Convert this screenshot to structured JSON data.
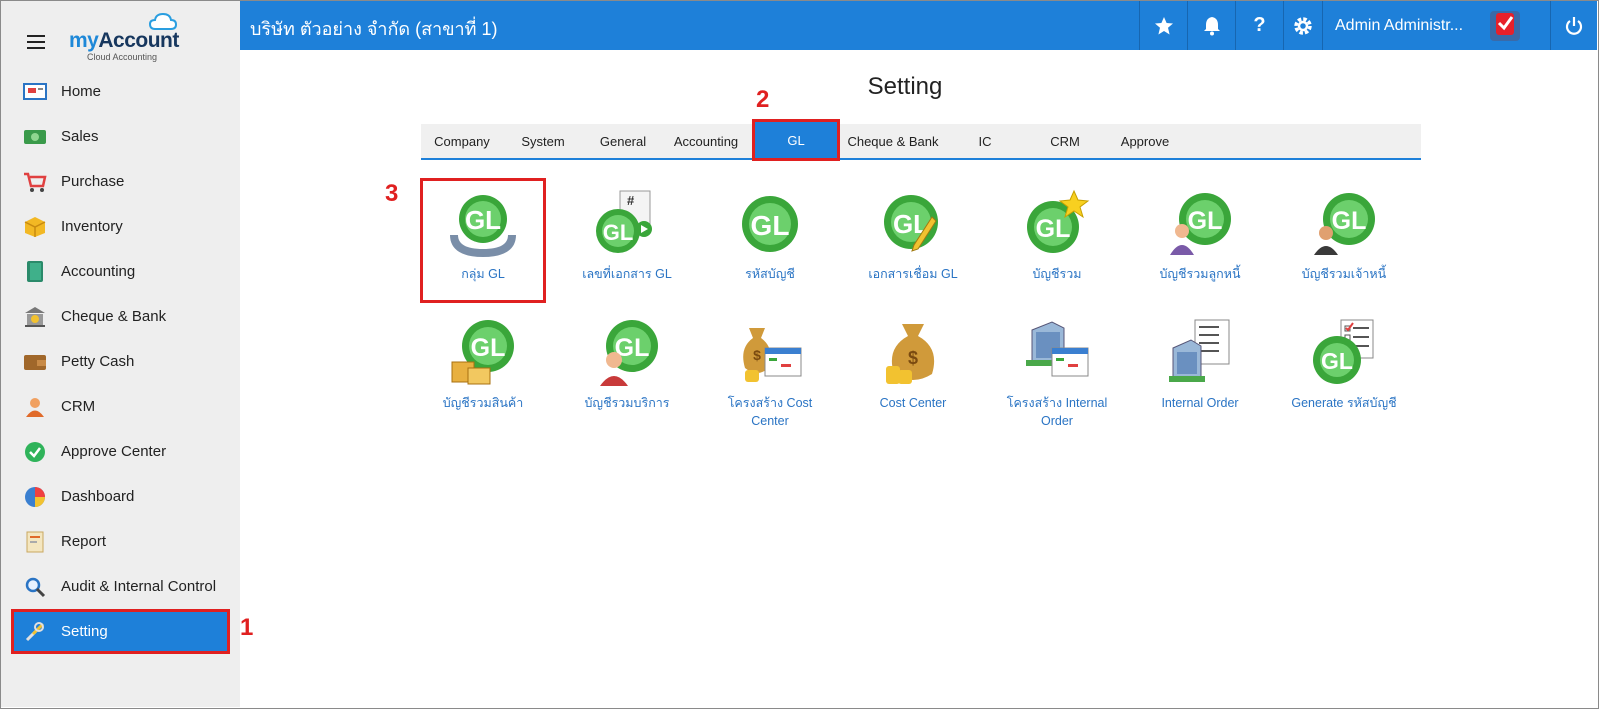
{
  "app": {
    "logo_text_my": "my",
    "logo_text_account": "Account",
    "logo_sub": "Cloud Accounting"
  },
  "topbar": {
    "company": "บริษัท ตัวอย่าง จำกัด (สาขาที่ 1)",
    "user": "Admin Administr...",
    "icons": [
      "star-icon",
      "bell-icon",
      "help-icon",
      "gear-icon",
      "power-icon"
    ]
  },
  "sidebar": {
    "items": [
      {
        "label": "Home",
        "icon": "home-icon"
      },
      {
        "label": "Sales",
        "icon": "money-icon"
      },
      {
        "label": "Purchase",
        "icon": "cart-icon"
      },
      {
        "label": "Inventory",
        "icon": "box-icon"
      },
      {
        "label": "Accounting",
        "icon": "book-icon"
      },
      {
        "label": "Cheque & Bank",
        "icon": "bank-icon"
      },
      {
        "label": "Petty Cash",
        "icon": "wallet-icon"
      },
      {
        "label": "CRM",
        "icon": "people-icon"
      },
      {
        "label": "Approve Center",
        "icon": "check-icon"
      },
      {
        "label": "Dashboard",
        "icon": "pie-icon"
      },
      {
        "label": "Report",
        "icon": "report-icon"
      },
      {
        "label": "Audit & Internal Control",
        "icon": "magnifier-icon"
      },
      {
        "label": "Setting",
        "icon": "tools-icon"
      }
    ]
  },
  "main": {
    "title": "Setting",
    "tabs": [
      "Company",
      "System",
      "General",
      "Accounting",
      "GL",
      "Cheque & Bank",
      "IC",
      "CRM",
      "Approve"
    ],
    "active_tab": "GL",
    "tiles": [
      {
        "label": "กลุ่ม GL",
        "icon": "gl-group-icon"
      },
      {
        "label": "เลขที่เอกสาร GL",
        "icon": "gl-docnumber-icon"
      },
      {
        "label": "รหัสบัญชี",
        "icon": "gl-account-code-icon"
      },
      {
        "label": "เอกสารเชื่อม GL",
        "icon": "gl-link-doc-icon"
      },
      {
        "label": "บัญชีรวม",
        "icon": "gl-star-icon"
      },
      {
        "label": "บัญชีรวมลูกหนี้",
        "icon": "gl-debtor-icon"
      },
      {
        "label": "บัญชีรวมเจ้าหนี้",
        "icon": "gl-creditor-icon"
      },
      {
        "label": "บัญชีรวมสินค้า",
        "icon": "gl-goods-icon"
      },
      {
        "label": "บัญชีรวมบริการ",
        "icon": "gl-service-icon"
      },
      {
        "label": "โครงสร้าง Cost Center",
        "icon": "money-bag-chart-icon"
      },
      {
        "label": "Cost Center",
        "icon": "money-bag-icon"
      },
      {
        "label": "โครงสร้าง Internal Order",
        "icon": "building-chart-icon"
      },
      {
        "label": "Internal Order",
        "icon": "building-list-icon"
      },
      {
        "label": "Generate รหัสบัญชี",
        "icon": "gl-checklist-icon"
      }
    ]
  },
  "annotations": [
    "1",
    "2",
    "3"
  ],
  "colors": {
    "primary": "#1e80d9",
    "highlight": "#e02020",
    "link": "#2a74c4",
    "sidebar_bg": "#eeeeee"
  }
}
